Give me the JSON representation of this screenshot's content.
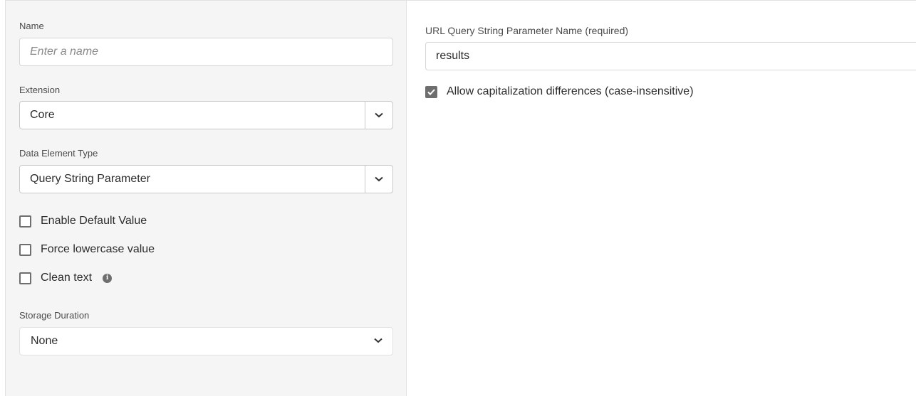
{
  "left": {
    "name": {
      "label": "Name",
      "placeholder": "Enter a name",
      "value": ""
    },
    "extension": {
      "label": "Extension",
      "value": "Core"
    },
    "data_element_type": {
      "label": "Data Element Type",
      "value": "Query String Parameter"
    },
    "checkboxes": [
      {
        "label": "Enable Default Value",
        "checked": false
      },
      {
        "label": "Force lowercase value",
        "checked": false
      },
      {
        "label": "Clean text",
        "checked": false,
        "info_icon": "info-icon"
      }
    ],
    "storage_duration": {
      "label": "Storage Duration",
      "value": "None"
    }
  },
  "right": {
    "param_name": {
      "label": "URL Query String Parameter Name (required)",
      "value": "results"
    },
    "case_insensitive": {
      "label": "Allow capitalization differences (case-insensitive)",
      "checked": true
    }
  },
  "colors": {
    "panel_bg": "#f5f5f5",
    "checkbox_checked": "#6e6e6e",
    "border": "#d6d6d6"
  }
}
